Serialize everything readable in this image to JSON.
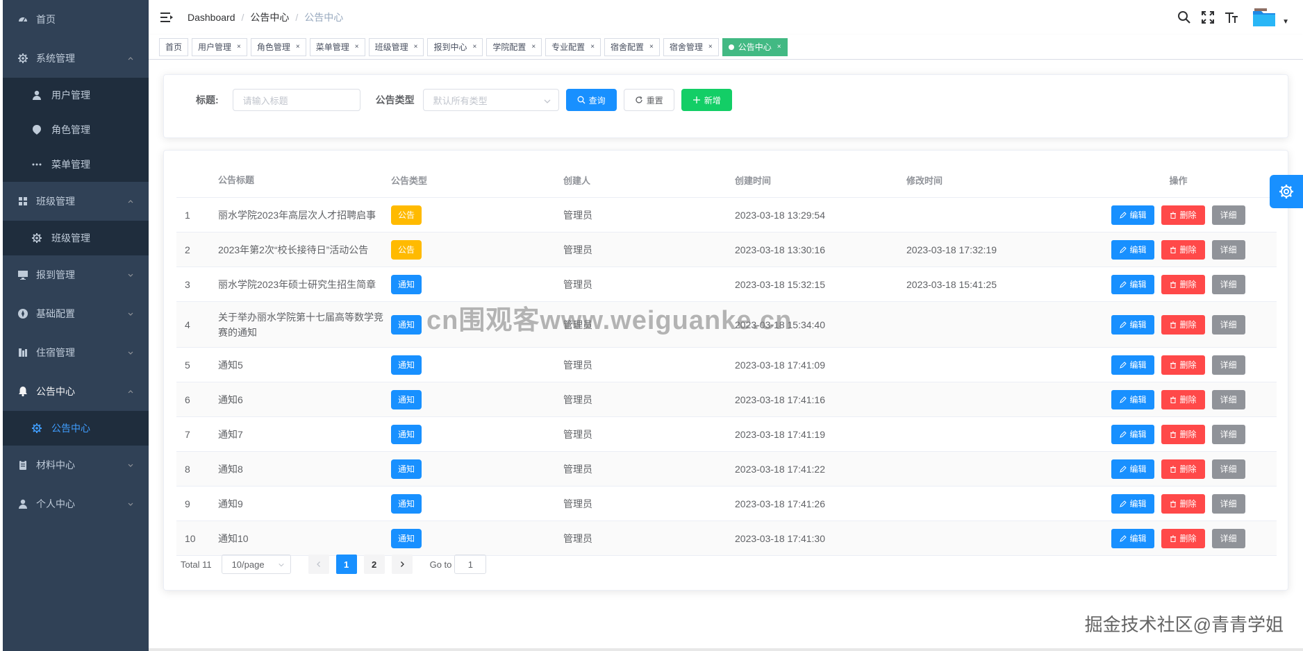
{
  "sidebar": {
    "items": [
      {
        "label": "首页",
        "icon": "dashboard-icon"
      },
      {
        "label": "系统管理",
        "icon": "gear-icon",
        "expanded": true,
        "children": [
          {
            "label": "用户管理",
            "icon": "user-icon"
          },
          {
            "label": "角色管理",
            "icon": "shield-icon"
          },
          {
            "label": "菜单管理",
            "icon": "dots-icon"
          }
        ]
      },
      {
        "label": "班级管理",
        "icon": "grid-icon",
        "expanded": true,
        "children": [
          {
            "label": "班级管理",
            "icon": "gear-icon"
          }
        ]
      },
      {
        "label": "报到管理",
        "icon": "monitor-icon"
      },
      {
        "label": "基础配置",
        "icon": "compass-icon"
      },
      {
        "label": "住宿管理",
        "icon": "building-icon"
      },
      {
        "label": "公告中心",
        "icon": "bell-icon",
        "expanded": true,
        "children": [
          {
            "label": "公告中心",
            "icon": "gear-icon",
            "active": true
          }
        ]
      },
      {
        "label": "材料中心",
        "icon": "clipboard-icon"
      },
      {
        "label": "个人中心",
        "icon": "user-icon"
      }
    ]
  },
  "breadcrumb": [
    "Dashboard",
    "公告中心",
    "公告中心"
  ],
  "tags": [
    {
      "label": "首页",
      "closable": false
    },
    {
      "label": "用户管理",
      "closable": true
    },
    {
      "label": "角色管理",
      "closable": true
    },
    {
      "label": "菜单管理",
      "closable": true
    },
    {
      "label": "班级管理",
      "closable": true
    },
    {
      "label": "报到中心",
      "closable": true
    },
    {
      "label": "学院配置",
      "closable": true
    },
    {
      "label": "专业配置",
      "closable": true
    },
    {
      "label": "宿舍配置",
      "closable": true
    },
    {
      "label": "宿舍管理",
      "closable": true
    },
    {
      "label": "公告中心",
      "closable": true,
      "active": true
    }
  ],
  "search": {
    "title_label": "标题:",
    "title_placeholder": "请输入标题",
    "type_label": "公告类型",
    "type_placeholder": "默认所有类型",
    "query_label": "查询",
    "reset_label": "重置",
    "add_label": "新增"
  },
  "table": {
    "headers": {
      "title": "公告标题",
      "type": "公告类型",
      "creator": "创建人",
      "ctime": "创建时间",
      "mtime": "修改时间",
      "ops": "操作"
    },
    "op_labels": {
      "edit": "编辑",
      "del": "删除",
      "detail": "详细"
    },
    "rows": [
      {
        "idx": "1",
        "title": "丽水学院2023年高层次人才招聘启事",
        "type": "公告",
        "kind": "warn",
        "creator": "管理员",
        "ctime": "2023-03-18 13:29:54",
        "mtime": ""
      },
      {
        "idx": "2",
        "title": "2023年第2次“校长接待日”活动公告",
        "type": "公告",
        "kind": "warn",
        "creator": "管理员",
        "ctime": "2023-03-18 13:30:16",
        "mtime": "2023-03-18 17:32:19"
      },
      {
        "idx": "3",
        "title": "丽水学院2023年硕士研究生招生简章",
        "type": "通知",
        "kind": "info",
        "creator": "管理员",
        "ctime": "2023-03-18 15:32:15",
        "mtime": "2023-03-18 15:41:25"
      },
      {
        "idx": "4",
        "title": "关于举办丽水学院第十七届高等数学竞赛的通知",
        "type": "通知",
        "kind": "info",
        "creator": "管理员",
        "ctime": "2023-03-18 15:34:40",
        "mtime": ""
      },
      {
        "idx": "5",
        "title": "通知5",
        "type": "通知",
        "kind": "info",
        "creator": "管理员",
        "ctime": "2023-03-18 17:41:09",
        "mtime": ""
      },
      {
        "idx": "6",
        "title": "通知6",
        "type": "通知",
        "kind": "info",
        "creator": "管理员",
        "ctime": "2023-03-18 17:41:16",
        "mtime": ""
      },
      {
        "idx": "7",
        "title": "通知7",
        "type": "通知",
        "kind": "info",
        "creator": "管理员",
        "ctime": "2023-03-18 17:41:19",
        "mtime": ""
      },
      {
        "idx": "8",
        "title": "通知8",
        "type": "通知",
        "kind": "info",
        "creator": "管理员",
        "ctime": "2023-03-18 17:41:22",
        "mtime": ""
      },
      {
        "idx": "9",
        "title": "通知9",
        "type": "通知",
        "kind": "info",
        "creator": "管理员",
        "ctime": "2023-03-18 17:41:26",
        "mtime": ""
      },
      {
        "idx": "10",
        "title": "通知10",
        "type": "通知",
        "kind": "info",
        "creator": "管理员",
        "ctime": "2023-03-18 17:41:30",
        "mtime": ""
      }
    ]
  },
  "pager": {
    "total": "Total 11",
    "size": "10/page",
    "pages": [
      "1",
      "2"
    ],
    "current": "1",
    "goto_label": "Go to",
    "goto_value": "1"
  },
  "watermark": {
    "center": "cn围观客www.weiguanke.cn",
    "bottom": "掘金技术社区@青青学姐"
  },
  "colors": {
    "sidebar_bg": "#304156",
    "submenu_bg": "#1f2d3d",
    "primary": "#1890ff",
    "danger": "#ff4949",
    "success": "#13ce66",
    "warning": "#ffba00",
    "tag_active": "#42b983"
  }
}
